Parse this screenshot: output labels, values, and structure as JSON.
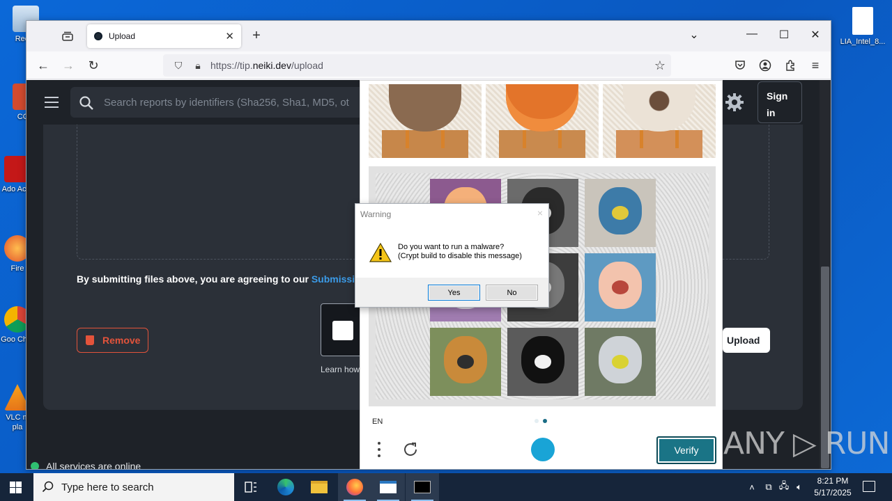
{
  "desktop": {
    "icons": [
      {
        "label": "Recyc"
      },
      {
        "label": "CCle"
      },
      {
        "label": "Ado Acro"
      },
      {
        "label": "Fire"
      },
      {
        "label": "Goo Chro"
      },
      {
        "label": "VLC m pla"
      },
      {
        "label": "LIA_Intel_8..."
      }
    ]
  },
  "browser": {
    "tab_title": "Upload",
    "url_host": "https://tip.",
    "url_domain": "neiki.dev",
    "url_path": "/upload"
  },
  "page": {
    "search_placeholder": "Search reports by identifiers (Sha256, Sha1, MD5, ot",
    "signin_label": "Sign in",
    "agree_text": "By submitting files above, you are agreeing to our ",
    "agree_link": "Submission",
    "remove_label": "Remove",
    "learn_text": "Learn how",
    "upload_label": "Upload",
    "status_text": "All services are online"
  },
  "captcha": {
    "lang": "EN",
    "verify_label": "Verify"
  },
  "dialog": {
    "title": "Warning",
    "close": "×",
    "message_line1": "Do you want to run a malware?",
    "message_line2": "(Crypt build to disable this message)",
    "yes_label": "Yes",
    "no_label": "No"
  },
  "watermark": "ANY ▷ RUN",
  "taskbar": {
    "search_placeholder": "Type here to search",
    "time": "8:21 PM",
    "date": "5/17/2025"
  },
  "colors": {
    "accent": "#1a7486",
    "danger": "#e3533b",
    "link": "#3b9be8"
  }
}
